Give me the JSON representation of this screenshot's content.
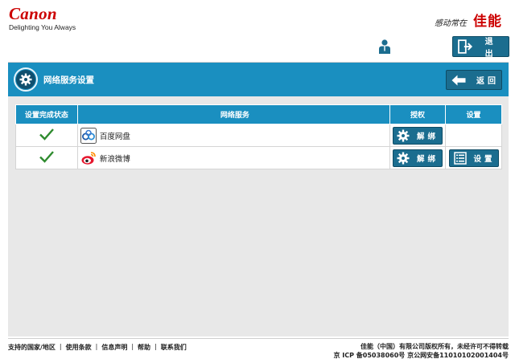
{
  "header": {
    "brand_name": "Canon",
    "brand_tagline": "Delighting You Always",
    "jp_tagline": "感动常在",
    "jp_brand": "佳能",
    "logout_label": "退出"
  },
  "panel": {
    "title": "网络服务设置",
    "back_label": "返回"
  },
  "table": {
    "headers": {
      "status": "设置完成状态",
      "service": "网络服务",
      "auth": "授权",
      "settings": "设置"
    },
    "rows": [
      {
        "service_name": "百度网盘",
        "service_icon": "baidu-cloud-icon",
        "status": "complete",
        "unbind_label": "解绑",
        "settings_label": ""
      },
      {
        "service_name": "新浪微博",
        "service_icon": "sina-weibo-icon",
        "status": "complete",
        "unbind_label": "解绑",
        "settings_label": "设置"
      }
    ]
  },
  "footer": {
    "links": [
      "支持的国家/地区",
      "使用条款",
      "信息声明",
      "帮助",
      "联系我们"
    ],
    "copyright": "佳能（中国）有限公司版权所有，未经许可不得转载",
    "icp": "京 ICP 备05038060号 京公网安备11010102001404号"
  },
  "colors": {
    "brand_red": "#cc0000",
    "header_blue": "#1a8fc0",
    "button_blue": "#1b6d8f",
    "check_green": "#2e8b2e",
    "panel_gray": "#e8e8e8"
  }
}
